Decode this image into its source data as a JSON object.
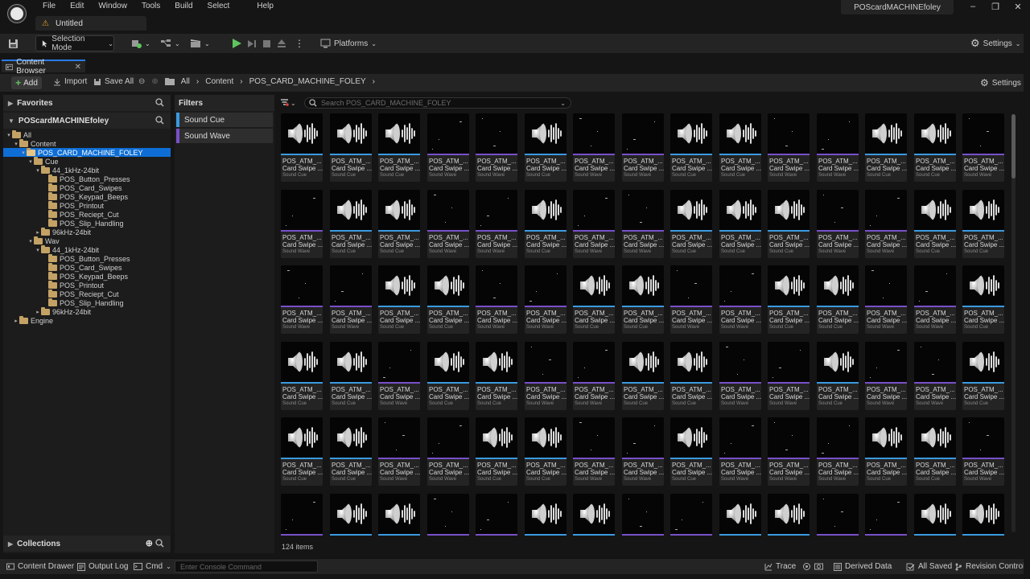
{
  "menu": [
    "File",
    "Edit",
    "Window",
    "Tools",
    "Build",
    "Select",
    "Help"
  ],
  "document_tab": "Untitled",
  "project_name": "POScardMACHINEfoley",
  "toolbar": {
    "selection_mode": "Selection Mode",
    "platforms": "Platforms",
    "settings": "Settings"
  },
  "content_browser": {
    "tab": "Content Browser",
    "add": "Add",
    "import": "Import",
    "save_all": "Save All",
    "settings": "Settings",
    "breadcrumb": [
      "All",
      "Content",
      "POS_CARD_MACHINE_FOLEY"
    ]
  },
  "sidebar": {
    "favorites": "Favorites",
    "project": "POScardMACHINEfoley",
    "collections": "Collections",
    "tree": [
      {
        "label": "All",
        "indent": 0,
        "exp": "▾"
      },
      {
        "label": "Content",
        "indent": 1,
        "exp": "▾"
      },
      {
        "label": "POS_CARD_MACHINE_FOLEY",
        "indent": 2,
        "exp": "▾",
        "selected": true
      },
      {
        "label": "Cue",
        "indent": 3,
        "exp": "▾"
      },
      {
        "label": "44_1kHz-24bit",
        "indent": 4,
        "exp": "▾"
      },
      {
        "label": "POS_Button_Presses",
        "indent": 5,
        "exp": ""
      },
      {
        "label": "POS_Card_Swipes",
        "indent": 5,
        "exp": ""
      },
      {
        "label": "POS_Keypad_Beeps",
        "indent": 5,
        "exp": ""
      },
      {
        "label": "POS_Printout",
        "indent": 5,
        "exp": ""
      },
      {
        "label": "POS_Reciept_Cut",
        "indent": 5,
        "exp": ""
      },
      {
        "label": "POS_Slip_Handling",
        "indent": 5,
        "exp": ""
      },
      {
        "label": "96kHz-24bit",
        "indent": 4,
        "exp": "▸"
      },
      {
        "label": "Wav",
        "indent": 3,
        "exp": "▾"
      },
      {
        "label": "44_1kHz-24bit",
        "indent": 4,
        "exp": "▾"
      },
      {
        "label": "POS_Button_Presses",
        "indent": 5,
        "exp": ""
      },
      {
        "label": "POS_Card_Swipes",
        "indent": 5,
        "exp": ""
      },
      {
        "label": "POS_Keypad_Beeps",
        "indent": 5,
        "exp": ""
      },
      {
        "label": "POS_Printout",
        "indent": 5,
        "exp": ""
      },
      {
        "label": "POS_Reciept_Cut",
        "indent": 5,
        "exp": ""
      },
      {
        "label": "POS_Slip_Handling",
        "indent": 5,
        "exp": ""
      },
      {
        "label": "96kHz-24bit",
        "indent": 4,
        "exp": "▸"
      },
      {
        "label": "Engine",
        "indent": 1,
        "exp": "▸"
      }
    ]
  },
  "filters": {
    "title": "Filters",
    "items": [
      {
        "label": "Sound Cue",
        "color": "#3b9adf"
      },
      {
        "label": "Sound Wave",
        "color": "#7850c8"
      }
    ]
  },
  "search_placeholder": "Search POS_CARD_MACHINE_FOLEY",
  "assets": {
    "name": "POS_ATM_...",
    "subname": "Card Swipe ...",
    "type_labels": {
      "c": "Sound Cue",
      "w": "Sound Wave"
    },
    "rows": [
      "cccwwcwwccwwccw",
      "wccwwcwwcccwwcc",
      "wwccwwccwwccwwc",
      "ccwccwwccwwcwwc",
      "ccwwccwwcwwwccw",
      "wccwwccwwccwwcc"
    ]
  },
  "items_count": "124 items",
  "statusbar": {
    "content_drawer": "Content Drawer",
    "output_log": "Output Log",
    "cmd": "Cmd",
    "console_placeholder": "Enter Console Command",
    "trace": "Trace",
    "derived_data": "Derived Data",
    "all_saved": "All Saved",
    "revision_control": "Revision Control"
  }
}
